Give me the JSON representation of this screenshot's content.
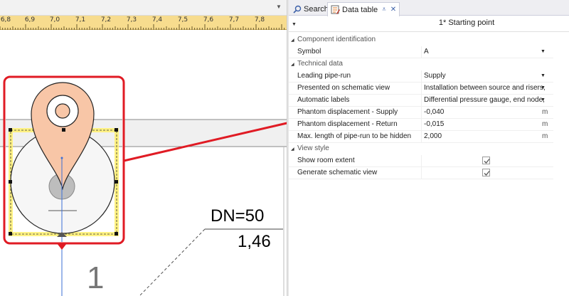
{
  "canvas": {
    "ruler_ticks": [
      "6,8",
      "6,9",
      "7,0",
      "7,1",
      "7,2",
      "7,3",
      "7,4",
      "7,5",
      "7,6",
      "7,7",
      "7,8"
    ],
    "dimension_label": "DN=50",
    "length_label": "1,46",
    "node_number": "1"
  },
  "tabs": {
    "search_label": "Search",
    "data_table_label": "Data table",
    "pin_glyph": "⩡",
    "close_glyph": "✕"
  },
  "header": {
    "title": "1* Starting point"
  },
  "groups": {
    "component": {
      "label": "Component identification",
      "symbol_name": "Symbol",
      "symbol_value": "A"
    },
    "technical": {
      "label": "Technical data",
      "leading_name": "Leading pipe-run",
      "leading_value": "Supply",
      "presented_name": "Presented on schematic view",
      "presented_value": "Installation between source and risers,",
      "auto_name": "Automatic labels",
      "auto_value": "Differential pressure gauge, end node,",
      "phantom_supply_name": "Phantom displacement - Supply",
      "phantom_supply_value": "-0,040",
      "phantom_supply_unit": "m",
      "phantom_return_name": "Phantom displacement - Return",
      "phantom_return_value": "-0,015",
      "phantom_return_unit": "m",
      "maxlen_name": "Max. length of pipe-run to be hidden",
      "maxlen_value": "2,000",
      "maxlen_unit": "m"
    },
    "view": {
      "label": "View style",
      "room_name": "Show room extent",
      "room_checked": true,
      "schematic_name": "Generate schematic view",
      "schematic_checked": true
    }
  },
  "colors": {
    "highlight": "#e01b24",
    "ruler": "#f7dc8e",
    "selection": "#fff176",
    "pin_fill": "#f8c6a7"
  }
}
